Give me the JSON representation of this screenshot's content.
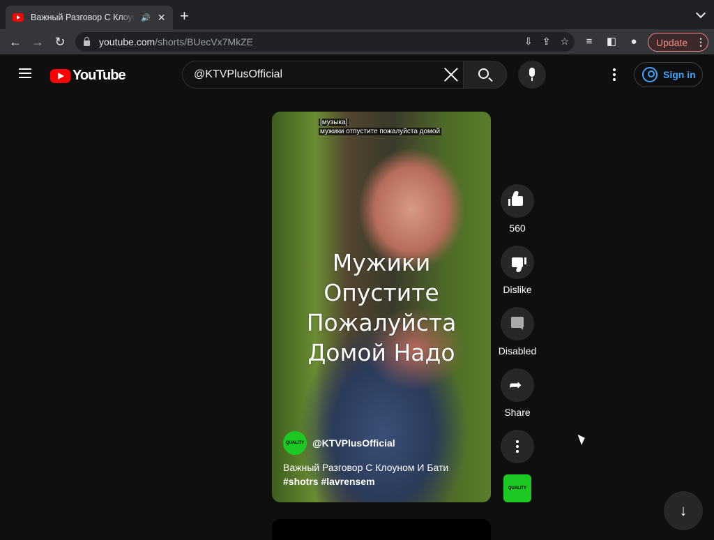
{
  "browser": {
    "tab_title": "Важный Разговор С Клоуном И Бати",
    "tab_audio_icon": "speaker-icon",
    "url_host": "youtube.com",
    "url_path": "/shorts/BUecVx7MkZE",
    "update_label": "Update"
  },
  "header": {
    "logo_text": "YouTube",
    "search_value": "@KTVPlusOfficial",
    "sign_in_label": "Sign in"
  },
  "video": {
    "captions": [
      "[музыка]",
      "мужики отпустите пожалуйста домой"
    ],
    "overlay_lines": [
      "Мужики",
      "Опустите",
      "Пожалуйста",
      "Домой Надо"
    ],
    "channel_handle": "@KTVPlusOfficial",
    "channel_avatar_text": "QUALITY",
    "title": "Важный Разговор С Клоуном И Бати",
    "hashtags": "#shotrs #lavrensem"
  },
  "actions": {
    "like_count": "560",
    "dislike_label": "Dislike",
    "comments_label": "Disabled",
    "share_label": "Share",
    "sound_thumb_text": "QUALITY"
  },
  "colors": {
    "brand_red": "#ff0000",
    "link_blue": "#3ea6ff",
    "channel_green": "#1cc922"
  }
}
